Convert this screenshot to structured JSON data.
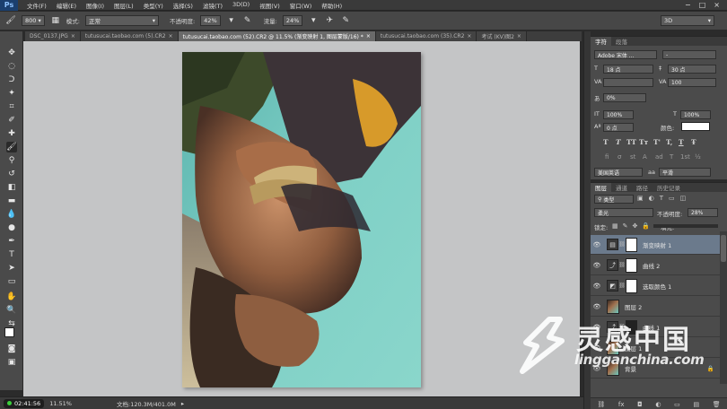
{
  "app": {
    "logo": "Ps"
  },
  "menu": [
    "文件(F)",
    "编辑(E)",
    "图像(I)",
    "图层(L)",
    "类型(Y)",
    "选择(S)",
    "滤镜(T)",
    "3D(D)",
    "视图(V)",
    "窗口(W)",
    "帮助(H)"
  ],
  "window_buttons": [
    "−",
    "□",
    "×"
  ],
  "options": {
    "brush_size": "800",
    "mode_label": "模式:",
    "mode_value": "正常",
    "opacity_label": "不透明度:",
    "opacity_value": "42%",
    "flow_label": "流量:",
    "flow_value": "24%",
    "workspace": "3D"
  },
  "tabs": [
    {
      "label": "DSC_0137.JPG",
      "close": "×"
    },
    {
      "label": "tutusucai.taobao.com (5).CR2",
      "close": "×"
    },
    {
      "label": "tutusucai.taobao.com (52).CR2 @ 11.5% (渐变映射 1, 图层蒙版/16) *",
      "close": "×"
    },
    {
      "label": "tutusucai.taobao.com (35).CR2",
      "close": "×"
    },
    {
      "label": "考试 (KV)图2",
      "close": "×"
    }
  ],
  "status": {
    "timer": "02:41:56",
    "zoom": "11.51%",
    "doc": "文档:120.3M/401.0M"
  },
  "character": {
    "tabs": [
      "字符",
      "段落"
    ],
    "font_family": "Adobe 宋体 ...",
    "font_style": "-",
    "font_size": "18 点",
    "leading": "30 点",
    "kerning": "",
    "tracking": "100",
    "scale_pct": "0%",
    "vscale": "100%",
    "hscale": "100%",
    "baseline": "0 点",
    "color_label": "颜色:",
    "type_buttons": [
      "T",
      "T",
      "TT",
      "Tт",
      "T'",
      "T,",
      "T",
      "Ŧ"
    ],
    "ot_buttons": [
      "fi",
      "σ",
      "st",
      "A",
      "ad",
      "T",
      "1st",
      "½"
    ],
    "language": "美国英语",
    "aa_label": "aa",
    "aa_value": "平滑"
  },
  "layers": {
    "tabs": [
      "图层",
      "通道",
      "路径",
      "历史记录"
    ],
    "filter": "类型",
    "blend_mode": "柔光",
    "opacity_label": "不透明度:",
    "opacity_value": "28%",
    "lock_label": "锁定:",
    "fill_label": "填充:",
    "items": [
      {
        "name": "渐变映射 1",
        "selected": true
      },
      {
        "name": "曲线 2",
        "selected": false
      },
      {
        "name": "选取颜色 1",
        "selected": false
      },
      {
        "name": "图层 2",
        "selected": false
      },
      {
        "name": "曲线 1",
        "selected": false
      },
      {
        "name": "图层 1",
        "selected": false
      },
      {
        "name": "背景",
        "selected": false
      }
    ],
    "footer_icons": [
      "⛓",
      "fx",
      "◘",
      "◐",
      "▭",
      "▤",
      "🗑"
    ]
  },
  "watermark": {
    "cn": "灵感中国",
    "url": "lingganchina.com"
  },
  "colors": {
    "accent_selection": "#6b7a8c",
    "panel_bg": "#4b4b4b",
    "canvas_bg": "#c4c5c6"
  }
}
